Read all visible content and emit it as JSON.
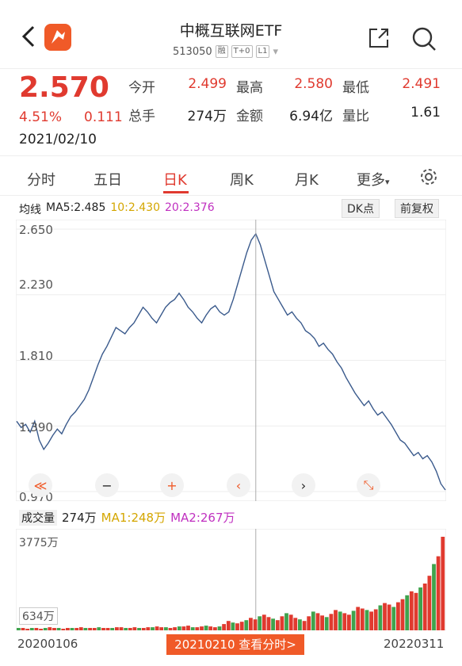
{
  "header": {
    "title": "中概互联网ETF",
    "code": "513050",
    "tags": [
      "融",
      "T+0",
      "L1"
    ],
    "dropdown": "▾"
  },
  "quote": {
    "price": "2.570",
    "change_pct": "4.51%",
    "change": "0.111",
    "date": "2021/02/10",
    "open_label": "今开",
    "open": "2.499",
    "high_label": "最高",
    "high": "2.580",
    "low_label": "最低",
    "low": "2.491",
    "hand_label": "总手",
    "hand": "274万",
    "amount_label": "金额",
    "amount": "6.94亿",
    "ratio_label": "量比",
    "ratio": "1.61"
  },
  "tabs": [
    "分时",
    "五日",
    "日K",
    "周K",
    "月K",
    "更多"
  ],
  "more_arrow": "▾",
  "ma": {
    "label": "均线",
    "ma5": "MA5:2.485",
    "ma10": "10:2.430",
    "ma20": "20:2.376",
    "dk": "DK点",
    "adjust": "前复权"
  },
  "colors": {
    "up": "#e03a2f",
    "line": "#3a5a8c",
    "ma10": "#e0b000",
    "ma20": "#c030c0",
    "accent": "#f05a28"
  },
  "chart_data": {
    "type": "line",
    "y_ticks": [
      "2.650",
      "2.230",
      "1.810",
      "1.390",
      "0.970"
    ],
    "ylim": [
      0.97,
      2.65
    ],
    "x_start": "20200106",
    "x_end": "20220311",
    "series": [
      {
        "values": [
          1.42,
          1.38,
          1.4,
          1.35,
          1.42,
          1.3,
          1.24,
          1.28,
          1.33,
          1.37,
          1.34,
          1.4,
          1.45,
          1.48,
          1.52,
          1.56,
          1.62,
          1.7,
          1.78,
          1.85,
          1.9,
          1.96,
          2.02,
          2.0,
          1.98,
          2.02,
          2.05,
          2.1,
          2.15,
          2.12,
          2.08,
          2.05,
          2.1,
          2.15,
          2.18,
          2.2,
          2.24,
          2.2,
          2.15,
          2.12,
          2.08,
          2.05,
          2.1,
          2.14,
          2.16,
          2.12,
          2.1,
          2.12,
          2.2,
          2.3,
          2.4,
          2.5,
          2.58,
          2.62,
          2.55,
          2.45,
          2.35,
          2.25,
          2.2,
          2.15,
          2.1,
          2.12,
          2.08,
          2.05,
          2.0,
          1.98,
          1.95,
          1.9,
          1.92,
          1.88,
          1.85,
          1.8,
          1.76,
          1.7,
          1.65,
          1.6,
          1.56,
          1.52,
          1.55,
          1.5,
          1.46,
          1.48,
          1.44,
          1.4,
          1.35,
          1.3,
          1.28,
          1.24,
          1.2,
          1.22,
          1.18,
          1.2,
          1.16,
          1.1,
          1.02,
          0.98
        ]
      }
    ]
  },
  "controls": [
    "≪",
    "−",
    "+",
    "‹",
    "›",
    "⤡"
  ],
  "volume": {
    "label": "成交量",
    "value": "274万",
    "ma1": "MA1:248万",
    "ma2": "MA2:267万",
    "top": "3775万",
    "bottom": "634万",
    "bars": [
      3,
      3,
      2,
      3,
      3,
      2,
      3,
      4,
      3,
      3,
      2,
      3,
      3,
      3,
      4,
      3,
      3,
      3,
      4,
      3,
      3,
      3,
      4,
      4,
      3,
      3,
      4,
      3,
      3,
      4,
      4,
      5,
      4,
      4,
      3,
      4,
      5,
      5,
      6,
      4,
      4,
      5,
      6,
      5,
      4,
      5,
      8,
      12,
      10,
      9,
      11,
      13,
      16,
      14,
      18,
      20,
      17,
      15,
      13,
      18,
      22,
      20,
      16,
      14,
      12,
      18,
      24,
      22,
      19,
      17,
      21,
      26,
      24,
      22,
      20,
      25,
      30,
      28,
      26,
      24,
      27,
      32,
      35,
      33,
      30,
      36,
      40,
      45,
      50,
      48,
      55,
      60,
      70,
      85,
      95,
      120
    ]
  },
  "footer": {
    "start": "20200106",
    "button": "20210210 查看分时>",
    "end": "20220311"
  }
}
